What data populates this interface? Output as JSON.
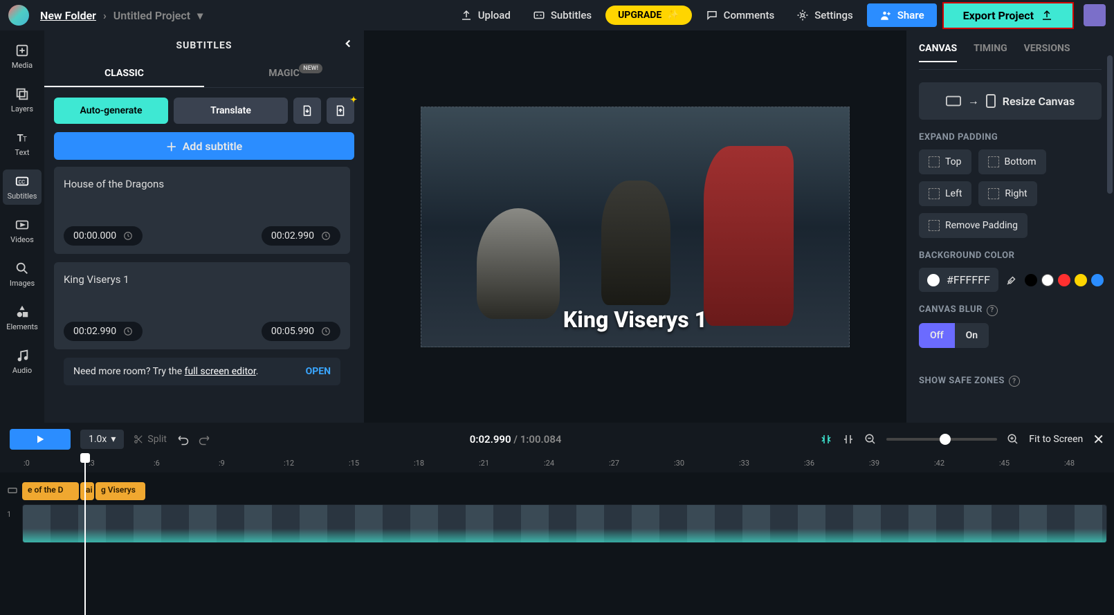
{
  "header": {
    "breadcrumb_folder": "New Folder",
    "breadcrumb_project": "Untitled Project",
    "upload": "Upload",
    "subtitles": "Subtitles",
    "upgrade": "UPGRADE",
    "comments": "Comments",
    "settings": "Settings",
    "share": "Share",
    "export": "Export Project"
  },
  "leftnav": {
    "items": [
      {
        "label": "Media"
      },
      {
        "label": "Layers"
      },
      {
        "label": "Text"
      },
      {
        "label": "Subtitles"
      },
      {
        "label": "Videos"
      },
      {
        "label": "Images"
      },
      {
        "label": "Elements"
      },
      {
        "label": "Audio"
      }
    ]
  },
  "subtitles_panel": {
    "title": "SUBTITLES",
    "tab_classic": "CLASSIC",
    "tab_magic": "MAGIC",
    "new_badge": "NEW!",
    "autogenerate": "Auto-generate",
    "translate": "Translate",
    "add_subtitle": "Add subtitle",
    "cards": [
      {
        "text": "House of the Dragons",
        "start": "00:00.000",
        "end": "00:02.990"
      },
      {
        "text": "King Viserys 1",
        "start": "00:02.990",
        "end": "00:05.990"
      }
    ],
    "fullscreen_prefix": "Need more room? Try the ",
    "fullscreen_link": "full screen editor",
    "fullscreen_suffix": ".",
    "open": "OPEN"
  },
  "preview": {
    "overlay_text": "King Viserys 1"
  },
  "right_panel": {
    "tabs": {
      "canvas": "CANVAS",
      "timing": "TIMING",
      "versions": "VERSIONS"
    },
    "resize": "Resize Canvas",
    "expand_padding": "EXPAND PADDING",
    "pad_top": "Top",
    "pad_bottom": "Bottom",
    "pad_left": "Left",
    "pad_right": "Right",
    "remove_padding": "Remove Padding",
    "bg_color": "BACKGROUND COLOR",
    "bg_hex": "#FFFFFF",
    "blur": "CANVAS BLUR",
    "blur_off": "Off",
    "blur_on": "On",
    "safe_zones": "SHOW SAFE ZONES",
    "palette": [
      "#000000",
      "#ffffff",
      "#ff3030",
      "#ffd500",
      "#2b8dff"
    ]
  },
  "timeline_ctrl": {
    "speed": "1.0x",
    "split": "Split",
    "current": "0:02.990",
    "total": "1:00.084",
    "fit": "Fit to Screen"
  },
  "timeline": {
    "ticks": [
      ":0",
      ":3",
      ":6",
      ":9",
      ":12",
      ":15",
      ":18",
      ":21",
      ":24",
      ":27",
      ":30",
      ":33",
      ":36",
      ":39",
      ":42",
      ":45",
      ":48"
    ],
    "clips": [
      "e of the D",
      "ai",
      "g Viserys"
    ],
    "track_label": "1"
  }
}
